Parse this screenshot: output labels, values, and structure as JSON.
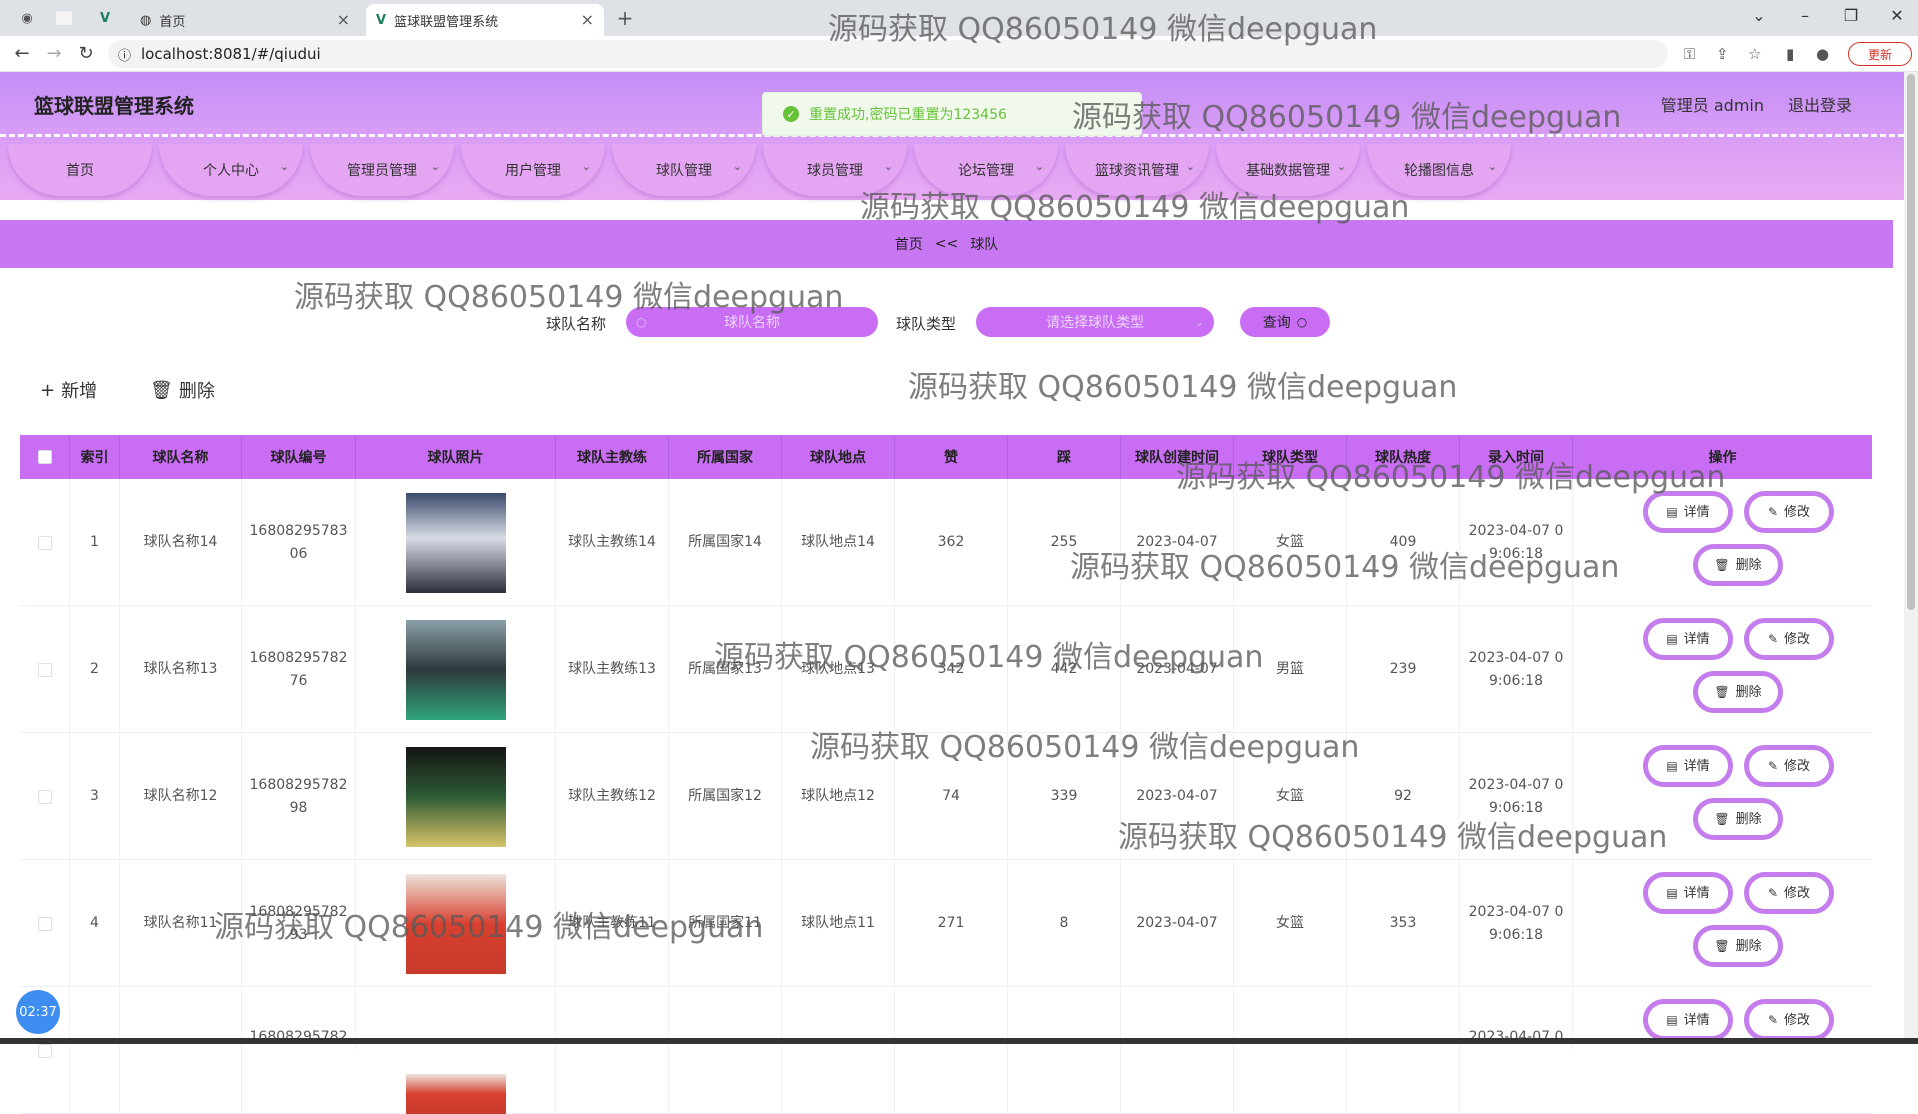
{
  "browser": {
    "tabs": [
      {
        "label": "首页"
      },
      {
        "label": "篮球联盟管理系统"
      }
    ],
    "new_tab": "+",
    "url": "localhost:8081/#/qiudui",
    "update_label": "更新"
  },
  "header": {
    "app_title": "篮球联盟管理系统",
    "admin_label": "管理员 admin",
    "logout_label": "退出登录"
  },
  "nav": {
    "items": [
      {
        "label": "首页"
      },
      {
        "label": "个人中心"
      },
      {
        "label": "管理员管理"
      },
      {
        "label": "用户管理"
      },
      {
        "label": "球队管理"
      },
      {
        "label": "球员管理"
      },
      {
        "label": "论坛管理"
      },
      {
        "label": "篮球资讯管理"
      },
      {
        "label": "基础数据管理"
      },
      {
        "label": "轮播图信息"
      }
    ]
  },
  "toast": {
    "message": "重置成功,密码已重置为123456"
  },
  "breadcrumb": {
    "home": "首页",
    "sep": "<<",
    "current": "球队"
  },
  "search": {
    "name_label": "球队名称",
    "name_placeholder": "球队名称",
    "type_label": "球队类型",
    "type_placeholder": "请选择球队类型",
    "query_label": "查询"
  },
  "actions": {
    "add_label": "新增",
    "delete_label": "删除"
  },
  "table": {
    "headers": [
      "索引",
      "球队名称",
      "球队编号",
      "球队照片",
      "球队主教练",
      "所属国家",
      "球队地点",
      "赞",
      "踩",
      "球队创建时间",
      "球队类型",
      "球队热度",
      "录入时间",
      "操作"
    ],
    "buttons": {
      "detail": "详情",
      "edit": "修改",
      "delete": "删除"
    },
    "rows": [
      {
        "index": "1",
        "name": "球队名称14",
        "code_l1": "16808295783",
        "code_l2": "06",
        "coach": "球队主教练14",
        "country": "所属国家14",
        "place": "球队地点14",
        "likes": "362",
        "dislikes": "255",
        "created": "2023-04-07",
        "type": "女篮",
        "heat": "409",
        "entered_l1": "2023-04-07 0",
        "entered_l2": "9:06:18"
      },
      {
        "index": "2",
        "name": "球队名称13",
        "code_l1": "16808295782",
        "code_l2": "76",
        "coach": "球队主教练13",
        "country": "所属国家13",
        "place": "球队地点13",
        "likes": "342",
        "dislikes": "442",
        "created": "2023-04-07",
        "type": "男篮",
        "heat": "239",
        "entered_l1": "2023-04-07 0",
        "entered_l2": "9:06:18"
      },
      {
        "index": "3",
        "name": "球队名称12",
        "code_l1": "16808295782",
        "code_l2": "98",
        "coach": "球队主教练12",
        "country": "所属国家12",
        "place": "球队地点12",
        "likes": "74",
        "dislikes": "339",
        "created": "2023-04-07",
        "type": "女篮",
        "heat": "92",
        "entered_l1": "2023-04-07 0",
        "entered_l2": "9:06:18"
      },
      {
        "index": "4",
        "name": "球队名称11",
        "code_l1": "16808295782",
        "code_l2": "93",
        "coach": "球队主教练11",
        "country": "所属国家11",
        "place": "球队地点11",
        "likes": "271",
        "dislikes": "8",
        "created": "2023-04-07",
        "type": "女篮",
        "heat": "353",
        "entered_l1": "2023-04-07 0",
        "entered_l2": "9:06:18"
      },
      {
        "index": "",
        "name": "",
        "code_l1": "16808295782",
        "code_l2": "",
        "coach": "",
        "country": "",
        "place": "",
        "likes": "",
        "dislikes": "",
        "created": "",
        "type": "",
        "heat": "",
        "entered_l1": "2023-04-07 0",
        "entered_l2": ""
      }
    ]
  },
  "watermark": "源码获取 QQ86050149 微信deepguan",
  "timer": "02:37",
  "colors": {
    "accent": "#c96ef4",
    "header_top": "#c48df7",
    "button_border": "#c57cec",
    "toast_text": "#67c23a"
  }
}
